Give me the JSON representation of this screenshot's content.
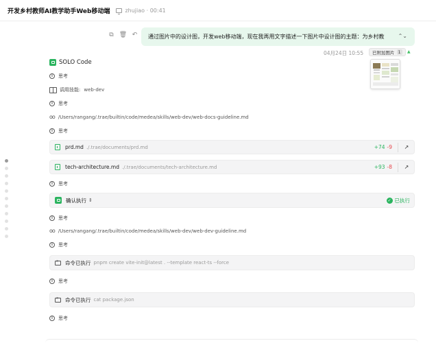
{
  "header": {
    "title": "开发乡村教师AI教学助手Web移动端",
    "user": "zhujiao",
    "separator": "·",
    "elapsed": "00:41"
  },
  "user_message": {
    "text": "通过图片中的设计图，开发web移动端，现在我再用文字描述一下图片中设计图的主题：为乡村教",
    "timestamp": "04月24日 10:55",
    "attachment_label": "已附加图片",
    "attachment_count": "1"
  },
  "agent": {
    "name": "SOLO Code"
  },
  "steps": {
    "thinking_label": "思考",
    "skill_label": "调用技能:",
    "skill_value": "web-dev",
    "read_path_1": "/Users/rangang/.trae/builtin/code/medea/skills/web-dev/web-docs-guideline.md",
    "read_path_2": "/Users/rangang/.trae/builtin/code/medea/skills/web-dev/web-dev-guideline.md"
  },
  "files": [
    {
      "name": "prd.md",
      "path": "./.trae/documents/prd.md",
      "added": "+74",
      "removed": "-9"
    },
    {
      "name": "tech-architecture.md",
      "path": "./.trae/documents/tech-architecture.md",
      "added": "+93",
      "removed": "-8"
    }
  ],
  "confirm": {
    "label": "确认执行",
    "status": "已执行"
  },
  "commands": [
    {
      "label": "命令已执行",
      "text": "pnpm create vite-init@latest . --template react-ts --force"
    },
    {
      "label": "命令已执行",
      "text": "cat package.json"
    }
  ],
  "colors": {
    "accent_green": "#2bb45f",
    "bubble_bg": "#e7f7ed",
    "diff_add": "#2bb45f",
    "diff_remove": "#e5484d",
    "card_bg": "#f4f4f5"
  },
  "icons": {
    "copy": "copy-icon",
    "delete": "trash-icon",
    "undo": "undo-icon",
    "monitor": "monitor-icon",
    "thinking": "thinking-icon",
    "skill": "book-icon",
    "read": "glasses-icon",
    "file": "file-edit-icon",
    "open": "arrow-up-right-icon",
    "terminal": "terminal-icon",
    "check": "check-circle-icon"
  }
}
